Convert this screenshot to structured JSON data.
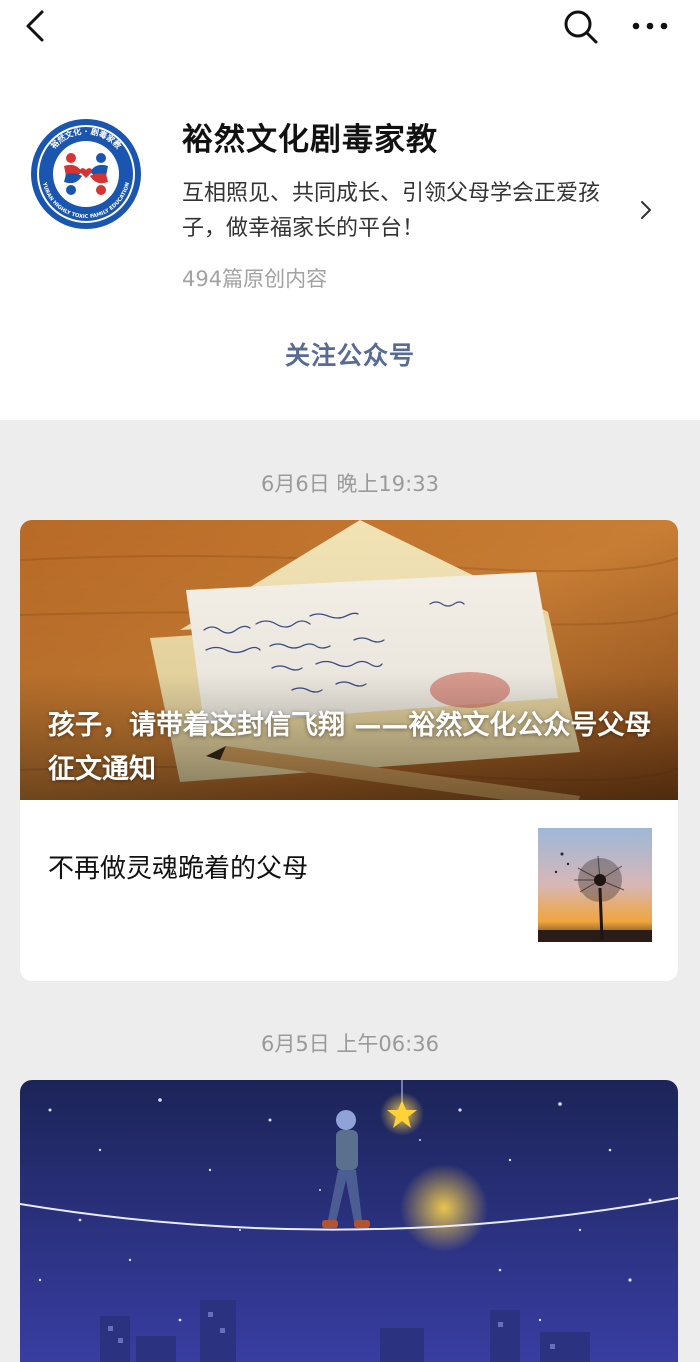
{
  "account": {
    "name": "裕然文化剧毒家教",
    "description": "互相照见、共同成长、引领父母学会正爱孩子，做幸福家长的平台！",
    "original_count": "494篇原创内容",
    "follow_label": "关注公众号",
    "logo_text": {
      "top": "裕然文化 · 剧毒家教",
      "bottom": "YURAN HIGHLY TOXIC FAMILY EDUCATION"
    }
  },
  "nav": {
    "back_icon": "chevron-left-icon",
    "search_icon": "search-icon",
    "more_icon": "more-dots-icon"
  },
  "feed": [
    {
      "date": "6月6日 晚上19:33",
      "main": {
        "title": "孩子，请带着这封信飞翔 ——裕然文化公众号父母征文通知",
        "image": "letter-envelope-photo",
        "letter_lines": [
          "Mein Liebster Schatz !",
          "19.2.07",
          "Was, aus es wir so schön aus",
          "für den Valentinstag",
          "noch in Luft"
        ]
      },
      "sub": {
        "title": "不再做灵魂跪着的父母",
        "image": "dandelion-sunset-photo"
      }
    },
    {
      "date": "6月5日 上午06:36",
      "main": {
        "image": "night-sky-tightrope-illustration"
      }
    }
  ],
  "colors": {
    "link": "#576b95",
    "background": "#ededed",
    "card": "#ffffff",
    "meta": "#9a9a9a",
    "logo_blue": "#1a56b0",
    "logo_red": "#d63333"
  }
}
